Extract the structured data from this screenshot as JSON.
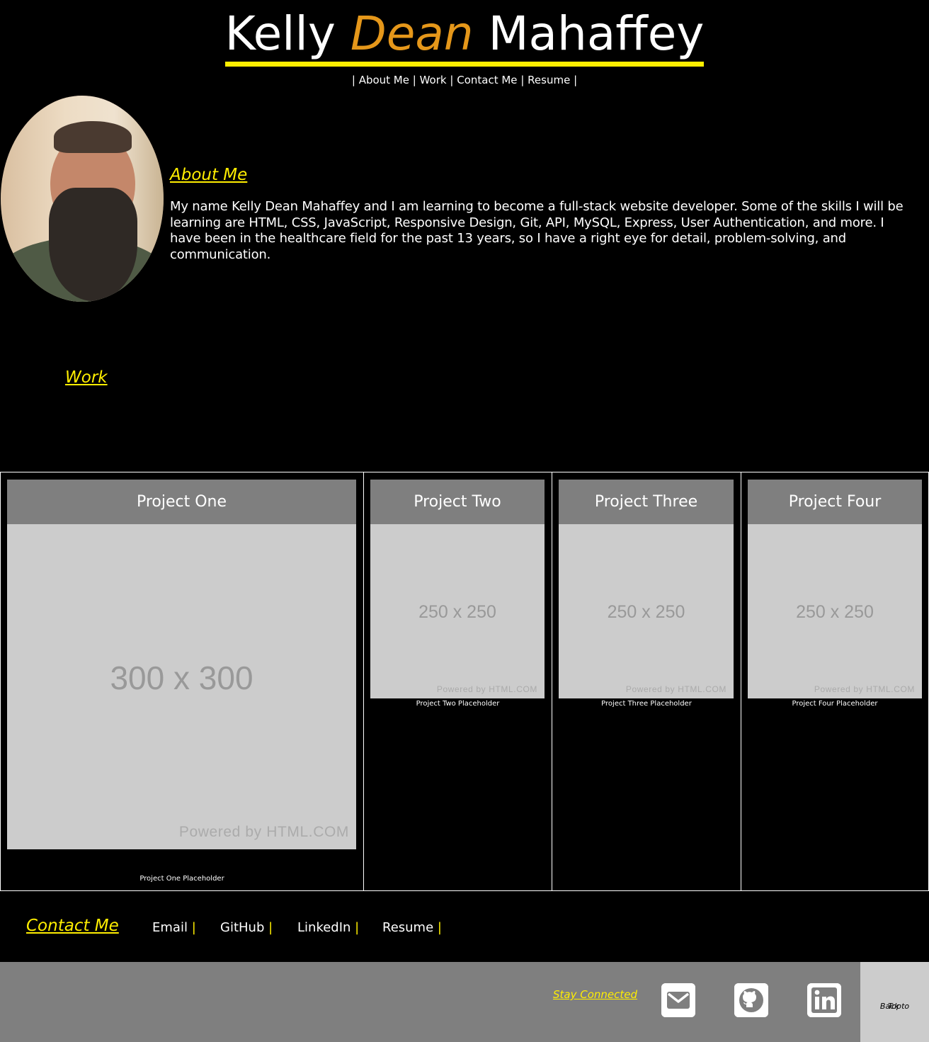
{
  "header": {
    "name_first": "Kelly",
    "name_middle": "Dean",
    "name_last": "Mahaffey",
    "nav": {
      "about": "About Me",
      "work": "Work",
      "contact": "Contact Me",
      "resume": "Resume"
    }
  },
  "about": {
    "heading": "About Me",
    "text": "My name Kelly Dean Mahaffey and I am learning to become a full-stack website developer. Some of the skills I will be learning are HTML, CSS, JavaScript, Responsive Design, Git, API, MySQL, Express, User Authentication, and more. I have been in the healthcare field for the past 13 years, so I have a right eye for detail, problem-solving, and communication."
  },
  "work": {
    "heading": "Work",
    "projects": [
      {
        "title": "Project One",
        "size": "300 x 300",
        "powered": "Powered by HTML.COM",
        "caption": "Project One Placeholder"
      },
      {
        "title": "Project Two",
        "size": "250 x 250",
        "powered": "Powered by HTML.COM",
        "caption": "Project Two Placeholder"
      },
      {
        "title": "Project Three",
        "size": "250 x 250",
        "powered": "Powered by HTML.COM",
        "caption": "Project Three Placeholder"
      },
      {
        "title": "Project Four",
        "size": "250 x 250",
        "powered": "Powered by HTML.COM",
        "caption": "Project Four Placeholder"
      }
    ]
  },
  "contact": {
    "heading": "Contact Me",
    "links": [
      "Email",
      "GitHub",
      "LinkedIn",
      "Resume"
    ]
  },
  "footer": {
    "stay_connected": "Stay Connected",
    "icons": [
      "email-icon",
      "github-icon",
      "linkedin-icon"
    ],
    "back_to_top_line1": "Back to",
    "back_to_top_line2": "Top"
  },
  "colors": {
    "accent_yellow": "#ffee00",
    "accent_orange": "#e5971a",
    "background": "#000000",
    "panel_gray": "#7f7f7f",
    "placeholder_gray": "#cccccc"
  }
}
